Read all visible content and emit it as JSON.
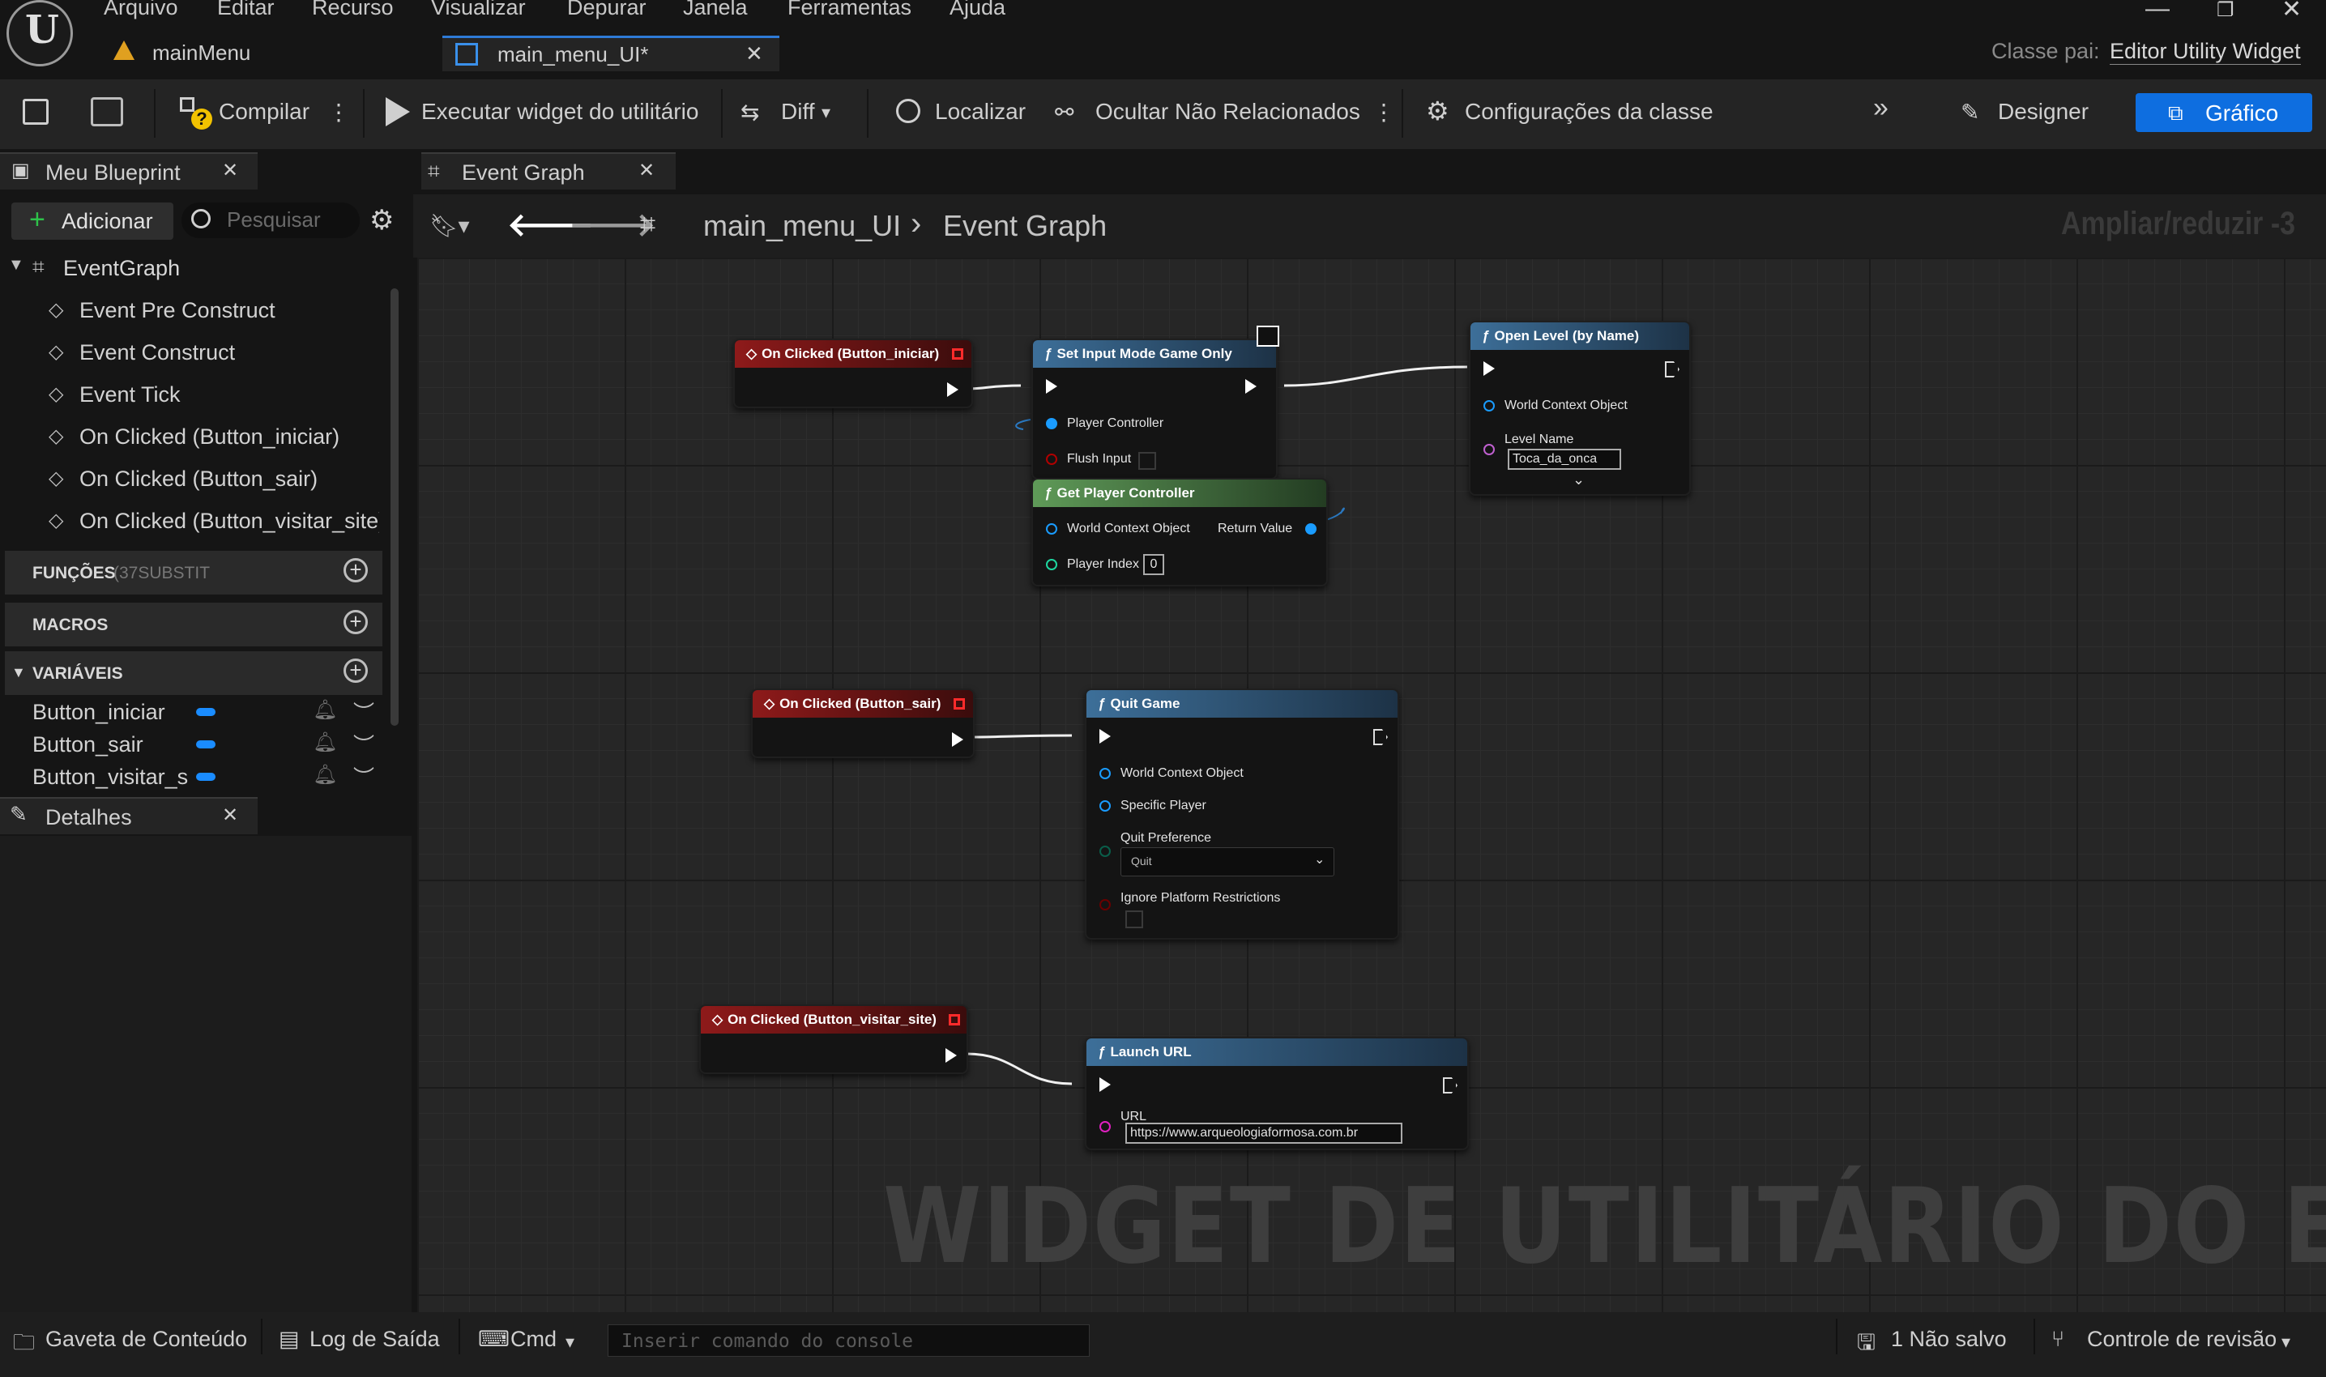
{
  "menu": [
    "Arquivo",
    "Editar",
    "Recurso",
    "Visualizar",
    "Depurar",
    "Janela",
    "Ferramentas",
    "Ajuda"
  ],
  "tabs": {
    "first": "mainMenu",
    "active": "main_menu_UI*"
  },
  "parent_class": {
    "label": "Classe pai:",
    "value": "Editor Utility Widget"
  },
  "toolbar": {
    "compile": "Compilar",
    "run_widget": "Executar widget do utilitário",
    "diff": "Diff",
    "find": "Localizar",
    "hide_unrelated": "Ocultar Não Relacionados",
    "class_settings": "Configurações da classe",
    "designer": "Designer",
    "graph": "Gráfico"
  },
  "my_blueprint": {
    "title": "Meu Blueprint",
    "add": "Adicionar",
    "search_placeholder": "Pesquisar",
    "event_graph": "EventGraph",
    "events": [
      "Event Pre Construct",
      "Event Construct",
      "Event Tick",
      "On Clicked (Button_iniciar)",
      "On Clicked (Button_sair)",
      "On Clicked (Button_visitar_site)"
    ],
    "functions_label": "FUNÇÕES",
    "functions_count": "(37SUBSTIT",
    "macros_label": "MACROS",
    "variables_label": "VARIÁVEIS",
    "variables": [
      "Button_iniciar",
      "Button_sair",
      "Button_visitar_s"
    ]
  },
  "details": {
    "title": "Detalhes"
  },
  "graph": {
    "tab": "Event Graph",
    "breadcrumb_root": "main_menu_UI",
    "breadcrumb_current": "Event Graph",
    "zoom": "Ampliar/reduzir -3",
    "watermark": "WIDGET DE UTILITÁRIO DO EDITOR",
    "nodes": {
      "evt_iniciar": "On Clicked (Button_iniciar)",
      "set_input": "Set Input Mode Game Only",
      "set_input_pc": "Player Controller",
      "set_input_flush": "Flush Input",
      "open_level": "Open Level (by Name)",
      "open_level_wco": "World Context Object",
      "open_level_ln": "Level Name",
      "open_level_value": "Toca_da_onca",
      "get_pc": "Get Player Controller",
      "get_pc_wco": "World Context Object",
      "get_pc_ret": "Return Value",
      "get_pc_index": "Player Index",
      "get_pc_index_value": "0",
      "evt_sair": "On Clicked (Button_sair)",
      "quit": "Quit Game",
      "quit_wco": "World Context Object",
      "quit_sp": "Specific Player",
      "quit_pref": "Quit Preference",
      "quit_pref_value": "Quit",
      "quit_ignore": "Ignore Platform Restrictions",
      "evt_site": "On Clicked (Button_visitar_site)",
      "launch": "Launch URL",
      "launch_url": "URL",
      "launch_url_value": "https://www.arqueologiaformosa.com.br"
    }
  },
  "status": {
    "content_drawer": "Gaveta de Conteúdo",
    "output_log": "Log de Saída",
    "cmd": "Cmd",
    "console_placeholder": "Inserir comando do console",
    "unsaved": "1 Não salvo",
    "source_control": "Controle de revisão"
  }
}
